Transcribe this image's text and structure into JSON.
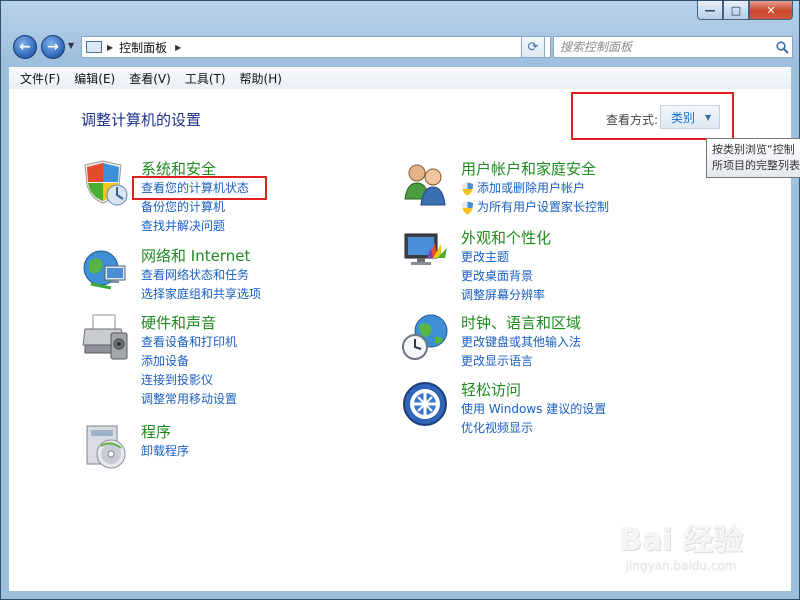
{
  "window": {
    "caption": {
      "minimize": "—",
      "maximize": "□",
      "close": "✕"
    }
  },
  "nav": {
    "back_icon": "arrow-left-icon",
    "forward_icon": "arrow-right-icon",
    "address": {
      "path": "控制面板",
      "icon": "control-panel-icon"
    },
    "refresh_icon": "refresh-icon",
    "search": {
      "placeholder": "搜索控制面板"
    }
  },
  "menu": {
    "items": [
      "文件(F)",
      "编辑(E)",
      "查看(V)",
      "工具(T)",
      "帮助(H)"
    ]
  },
  "content": {
    "title": "调整计算机的设置",
    "view_by_label": "查看方式:",
    "view_mode": "类别",
    "tooltip_lines": [
      "按类别浏览“控制",
      "所项目的完整列表"
    ]
  },
  "categories": {
    "system": {
      "title": "系统和安全",
      "icon": "shield-computer-icon",
      "links": [
        "查看您的计算机状态",
        "备份您的计算机",
        "查找并解决问题"
      ]
    },
    "network": {
      "title": "网络和 Internet",
      "icon": "network-globe-icon",
      "links": [
        "查看网络状态和任务",
        "选择家庭组和共享选项"
      ]
    },
    "hardware": {
      "title": "硬件和声音",
      "icon": "printer-icon",
      "links": [
        "查看设备和打印机",
        "添加设备",
        "连接到投影仪",
        "调整常用移动设置"
      ]
    },
    "programs": {
      "title": "程序",
      "icon": "programs-disc-icon",
      "links": [
        "卸载程序"
      ]
    },
    "users": {
      "title": "用户帐户和家庭安全",
      "icon": "users-icon",
      "links": [
        "添加或删除用户帐户",
        "为所有用户设置家长控制"
      ]
    },
    "appearance": {
      "title": "外观和个性化",
      "icon": "monitor-palette-icon",
      "links": [
        "更改主题",
        "更改桌面背景",
        "调整屏幕分辨率"
      ]
    },
    "clock": {
      "title": "时钟、语言和区域",
      "icon": "clock-globe-icon",
      "links": [
        "更改键盘或其他输入法",
        "更改显示语言"
      ]
    },
    "ease": {
      "title": "轻松访问",
      "icon": "ease-of-access-icon",
      "links": [
        "使用 Windows 建议的设置",
        "优化视频显示"
      ]
    }
  },
  "watermark": {
    "main": "Bai 经验",
    "sub": "jingyan.baidu.com"
  }
}
